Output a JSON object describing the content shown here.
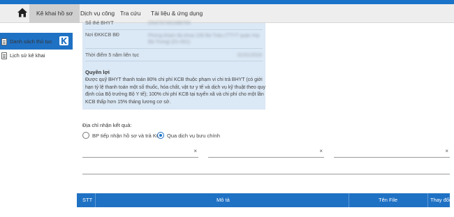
{
  "nav": {
    "items": [
      {
        "label": "Kê khai hồ sơ",
        "active": true
      },
      {
        "label": "Dịch vụ công",
        "active": false
      },
      {
        "label": "Tra cứu",
        "active": false
      },
      {
        "label": "Tài liệu & ứng dụng",
        "active": false
      }
    ]
  },
  "sidebar": {
    "items": [
      {
        "label": "Danh sách thủ tục"
      },
      {
        "label": "Lịch sử kê khai"
      }
    ]
  },
  "info": {
    "rows": [
      {
        "label": "Số thẻ BHYT",
        "value": "DN4797491088765"
      },
      {
        "label": "Nơi ĐKKCB BĐ",
        "value": "Phòng khám đa khoa 108 Bà Triệu (TTYT quận Hai Bà Trưng) (01-061)"
      },
      {
        "label": "Thời điểm 5 năm liên tục",
        "value": "01/01/2024"
      }
    ],
    "benefit_title": "Quyền lợi",
    "benefit_text": "Được quỹ BHYT thanh toán 80% chi phí KCB thuộc phạm vi chi trả BHYT (có giới hạn tỷ lệ thanh toán một số thuốc, hóa chất, vật tư y tế và dịch vụ kỹ thuật theo quy định của Bộ trưởng Bộ Y tế); 100% chi phí KCB tại tuyến xã và chi phí cho một lần KCB thấp hơn 15% tháng lương cơ sở."
  },
  "address": {
    "title": "Địa chỉ nhận kết quả:",
    "options": [
      {
        "label": "BP tiếp nhận hồ sơ và trả KQ",
        "checked": false
      },
      {
        "label": "Qua dịch vụ bưu chính",
        "checked": true
      }
    ],
    "clear_glyph": "×"
  },
  "table": {
    "headers": [
      "STT",
      "Mô tả",
      "Tên File",
      "Thay đổi"
    ]
  },
  "colors": {
    "brand_blue": "#1f71c4",
    "panel_bg": "#dbe8f5"
  }
}
